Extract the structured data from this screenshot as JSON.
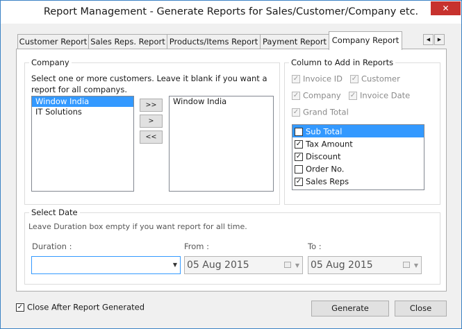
{
  "window": {
    "title": "Report Management - Generate Reports for Sales/Customer/Company etc.",
    "close_glyph": "✕"
  },
  "tabs": [
    {
      "label": "Customer Report"
    },
    {
      "label": "Sales Reps. Report"
    },
    {
      "label": "Products/Items Report"
    },
    {
      "label": "Payment Report"
    },
    {
      "label": "Company Report"
    }
  ],
  "tab_scroll": {
    "left": "◀",
    "right": "▶"
  },
  "company": {
    "legend": "Company",
    "instruction": "Select one or more customers. Leave it blank if you want a report for all companys.",
    "available": [
      "Window India",
      "IT Solutions"
    ],
    "selected": [
      "Window India"
    ],
    "buttons": {
      "add_all": ">>",
      "add": ">",
      "remove_all": "<<"
    }
  },
  "columns": {
    "legend": "Column to Add in Reports",
    "fixed": [
      {
        "label": "Invoice ID",
        "checked": true
      },
      {
        "label": "Customer",
        "checked": true
      },
      {
        "label": "Company",
        "checked": true
      },
      {
        "label": "Invoice Date",
        "checked": true
      },
      {
        "label": "Grand Total",
        "checked": true
      }
    ],
    "optional": [
      {
        "label": "Sub Total",
        "checked": true
      },
      {
        "label": "Tax Amount",
        "checked": true
      },
      {
        "label": "Discount",
        "checked": true
      },
      {
        "label": "Order No.",
        "checked": false
      },
      {
        "label": "Sales Reps",
        "checked": true
      }
    ]
  },
  "select_date": {
    "legend": "Select Date",
    "instruction": "Leave Duration box empty if you want report for all time.",
    "duration_label": "Duration :",
    "duration_value": "",
    "from_label": "From :",
    "from_value": "05 Aug 2015",
    "to_label": "To :",
    "to_value": "05 Aug 2015"
  },
  "footer": {
    "close_after_label": "Close After Report Generated",
    "close_after_checked": true,
    "generate_label": "Generate",
    "close_label": "Close"
  },
  "colors": {
    "selection": "#3399ff",
    "close_button": "#c7322e",
    "window_border": "#3b82c4"
  }
}
